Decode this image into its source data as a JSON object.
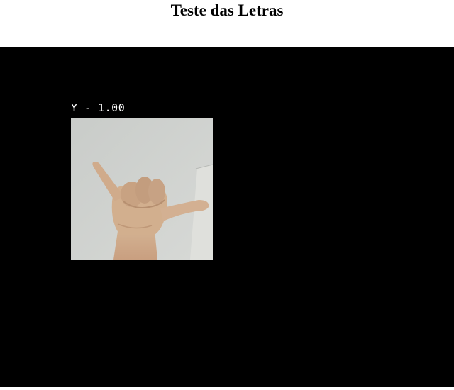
{
  "page": {
    "title": "Teste das Letras"
  },
  "video": {
    "prediction_label": "Y - 1.00",
    "hand_image": "hand-sign-y"
  }
}
